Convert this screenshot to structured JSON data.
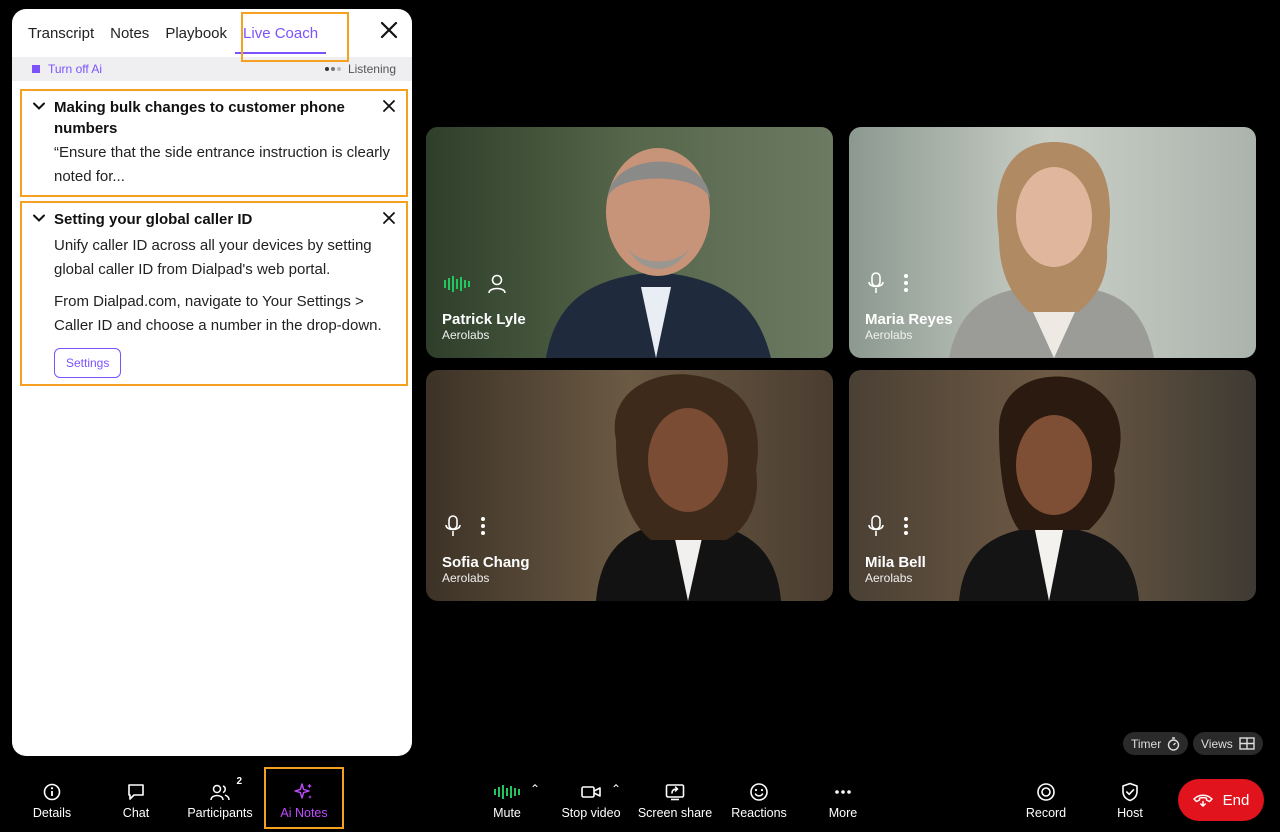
{
  "panel": {
    "tabs": [
      {
        "label": "Transcript"
      },
      {
        "label": "Notes"
      },
      {
        "label": "Playbook"
      },
      {
        "label": "Live Coach",
        "active": true
      }
    ],
    "close_icon": "close-icon",
    "turn_off_label": "Turn off Ai",
    "status_label": "Listening",
    "cards": [
      {
        "title": "Making bulk changes to customer phone numbers",
        "body": [
          "“Ensure that the side entrance instruction is clearly noted for..."
        ]
      },
      {
        "title": "Setting your global caller ID",
        "body": [
          "Unify caller ID across all your devices by setting global caller ID from Dialpad's web portal.",
          "From Dialpad.com, navigate to Your Settings > Caller ID and choose a number in the drop-down."
        ],
        "button": "Settings"
      }
    ]
  },
  "participants": [
    {
      "name": "Patrick Lyle",
      "org": "Aerolabs",
      "speaking": true
    },
    {
      "name": "Maria Reyes",
      "org": "Aerolabs"
    },
    {
      "name": "Sofia Chang",
      "org": "Aerolabs"
    },
    {
      "name": "Mila Bell",
      "org": "Aerolabs"
    }
  ],
  "pills": {
    "timer": "Timer",
    "views": "Views"
  },
  "toolbar": {
    "details": "Details",
    "chat": "Chat",
    "participants": "Participants",
    "participants_count": "2",
    "ai_notes": "Ai Notes",
    "mute": "Mute",
    "stop_video": "Stop video",
    "screen_share": "Screen share",
    "reactions": "Reactions",
    "more": "More",
    "record": "Record",
    "host": "Host",
    "end": "End"
  },
  "colors": {
    "accent": "#7c52ff",
    "highlight": "#f5a020",
    "end": "#e1141d",
    "speaking": "#22c55e",
    "ai_icon": "#c04bff"
  }
}
